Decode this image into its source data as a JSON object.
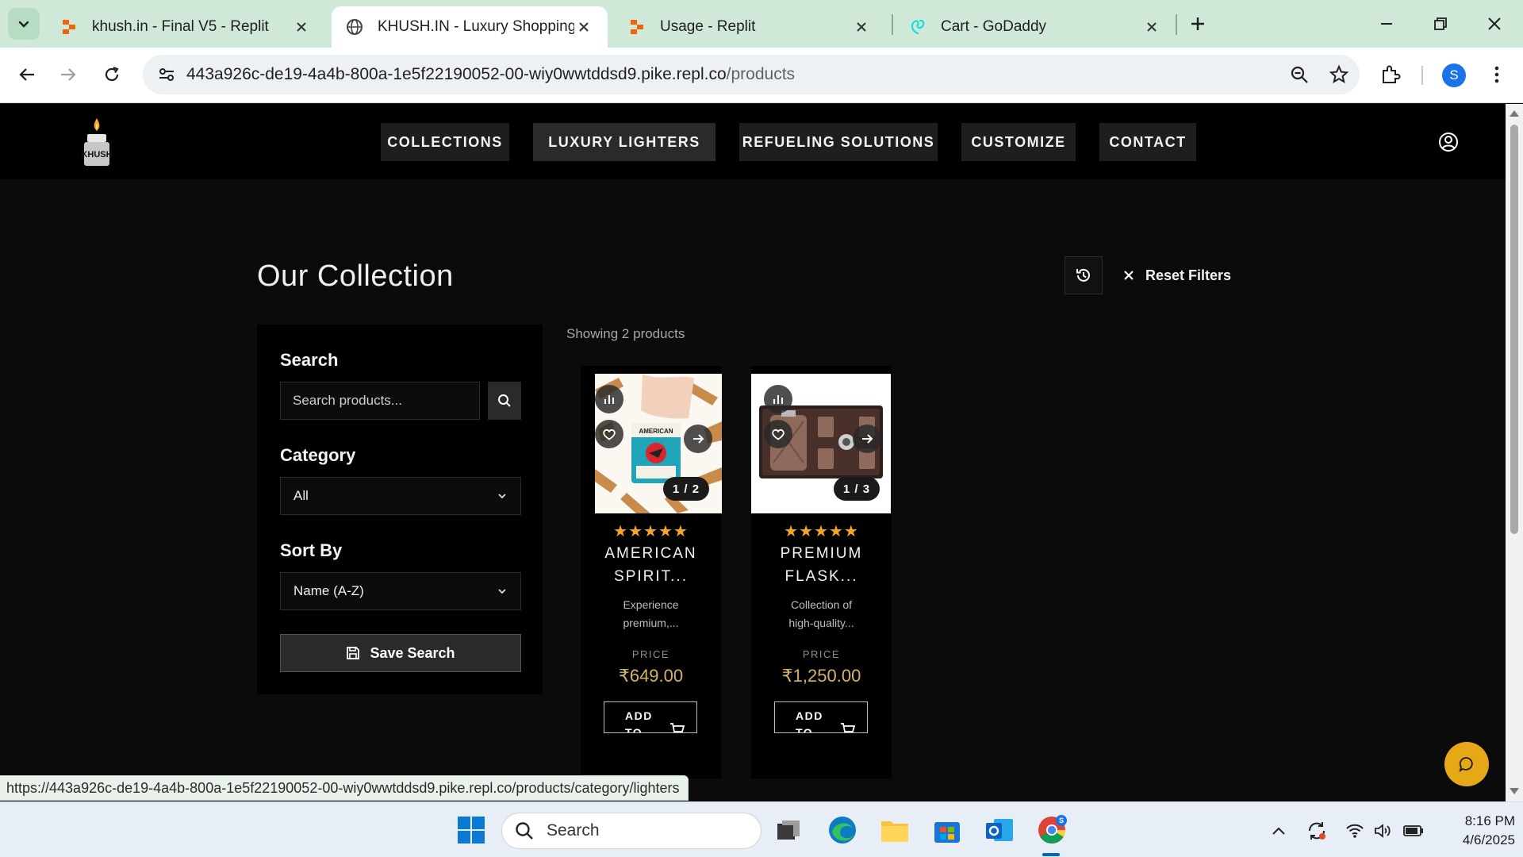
{
  "browser": {
    "tabs": [
      {
        "title": "khush.in - Final V5 - Replit",
        "icon": "replit-icon",
        "active": false
      },
      {
        "title": "KHUSH.IN - Luxury Shopping Ex",
        "icon": "globe-icon",
        "active": true
      },
      {
        "title": "Usage - Replit",
        "icon": "replit-icon",
        "active": false
      },
      {
        "title": "Cart - GoDaddy",
        "icon": "godaddy-icon",
        "active": false
      }
    ],
    "url_host": "443a926c-de19-4a4b-800a-1e5f22190052-00-wiy0wwtddsd9.pike.repl.co",
    "url_path": "/products",
    "profile_initial": "S",
    "status_url": "https://443a926c-de19-4a4b-800a-1e5f22190052-00-wiy0wwtddsd9.pike.repl.co/products/category/lighters"
  },
  "site": {
    "logo_text": "KHUSH",
    "nav": [
      {
        "label": "COLLECTIONS"
      },
      {
        "label": "LUXURY LIGHTERS"
      },
      {
        "label": "REFUELING SOLUTIONS"
      },
      {
        "label": "CUSTOMIZE"
      },
      {
        "label": "CONTACT"
      }
    ],
    "page_title": "Our Collection",
    "reset_label": "Reset Filters",
    "filters": {
      "search_label": "Search",
      "search_placeholder": "Search products...",
      "category_label": "Category",
      "category_value": "All",
      "sort_label": "Sort By",
      "sort_value": "Name (A-Z)",
      "save_label": "Save Search"
    },
    "showing_text": "Showing 2 products",
    "products": [
      {
        "name_line1": "AMERICAN",
        "name_line2": "SPIRIT...",
        "desc_line1": "Experience",
        "desc_line2": "premium,...",
        "price_label": "PRICE",
        "price": "₹649.00",
        "image_counter": "1 / 2",
        "rating_stars": "★★★★★",
        "add_line1": "ADD",
        "add_line2": "TO"
      },
      {
        "name_line1": "PREMIUM",
        "name_line2": "FLASK...",
        "desc_line1": "Collection of",
        "desc_line2": "high-quality...",
        "price_label": "PRICE",
        "price": "₹1,250.00",
        "image_counter": "1 / 3",
        "rating_stars": "★★★★★",
        "add_line1": "ADD",
        "add_line2": "TO"
      }
    ],
    "accent_color": "#e6a817",
    "price_color": "#d4b26a"
  },
  "taskbar": {
    "search_placeholder": "Search",
    "time": "8:16 PM",
    "date": "4/6/2025"
  }
}
